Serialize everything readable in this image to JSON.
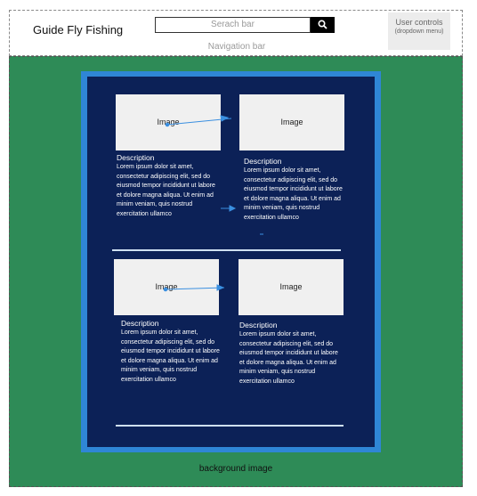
{
  "navbar": {
    "brand": "Guide Fly Fishing",
    "search_placeholder": "Serach bar",
    "caption": "Navigation bar",
    "user_controls_line1": "User controls",
    "user_controls_line2": "(dropdown menu)"
  },
  "background_caption": "background image",
  "cards": [
    {
      "image_label": "Image",
      "desc_title": "Description",
      "desc_body": "Lorem ipsum dolor sit amet, consectetur adipiscing elit, sed do eiusmod tempor incididunt ut labore et dolore magna aliqua. Ut enim ad minim veniam, quis nostrud exercitation ullamco"
    },
    {
      "image_label": "Image",
      "desc_title": "Description",
      "desc_body": "Lorem ipsum dolor sit amet, consectetur adipiscing elit, sed do eiusmod tempor incididunt ut labore et dolore magna aliqua. Ut enim ad minim veniam, quis nostrud exercitation ullamco"
    },
    {
      "image_label": "Image",
      "desc_title": "Description",
      "desc_body": "Lorem ipsum dolor sit amet, consectetur adipiscing elit, sed do eiusmod tempor incididunt ut labore et dolore magna aliqua. Ut enim ad minim veniam, quis nostrud exercitation ullamco"
    },
    {
      "image_label": "Image",
      "desc_title": "Description",
      "desc_body": "Lorem ipsum dolor sit amet, consectetur adipiscing elit, sed do eiusmod tempor incididunt ut labore et dolore magna aliqua. Ut enim ad minim veniam, quis nostrud exercitation ullamco"
    }
  ],
  "colors": {
    "background_green": "#2e8b57",
    "panel_blue": "#2f86d6",
    "panel_navy": "#0c2157",
    "connector_blue": "#3a8fe0"
  },
  "icons": {
    "search_button": "search-icon"
  }
}
